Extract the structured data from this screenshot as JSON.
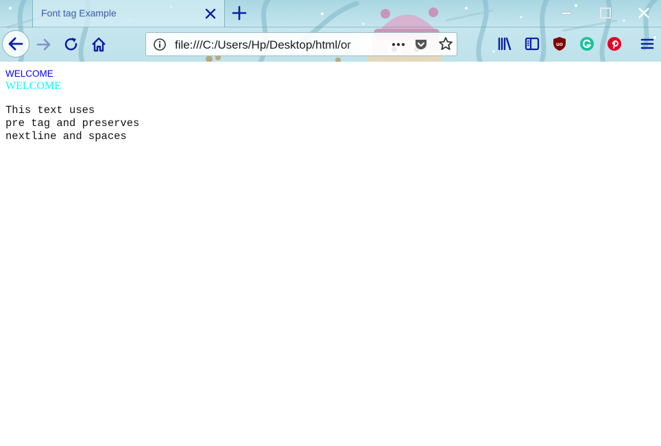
{
  "browser": {
    "tab": {
      "title": "Font tag Example"
    },
    "url": "file:///C:/Users/Hp/Desktop/html/or",
    "colors": {
      "accent": "#0a1fa3",
      "tab_text": "#3a5aa8",
      "ublock": "#800000",
      "grammarly": "#15c39a",
      "pinterest": "#e60023"
    }
  },
  "page": {
    "font_small": "WELCOME",
    "font_small_color": "#0000ff",
    "font_large": "WELCOME",
    "font_large_color": "#00ffff",
    "pre_text": "This text uses\npre tag and preserves\nnextline and spaces"
  }
}
